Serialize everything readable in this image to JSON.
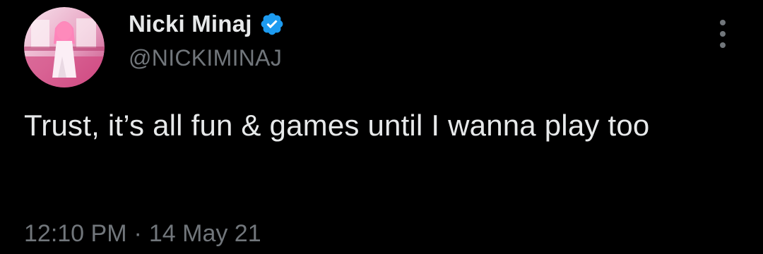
{
  "user": {
    "display_name": "Nicki Minaj",
    "handle": "@NICKIMINAJ",
    "verified": true
  },
  "icons": {
    "verified": "verified-badge-icon",
    "more": "more-vertical-icon"
  },
  "tweet": {
    "text": "Trust, it’s all fun & games until I wanna play too",
    "time": "12:10 PM",
    "separator": "·",
    "date": "14 May 21"
  },
  "colors": {
    "background": "#000000",
    "text_primary": "#e7e9ea",
    "text_secondary": "#71767b",
    "verified_blue": "#1d9bf0"
  }
}
